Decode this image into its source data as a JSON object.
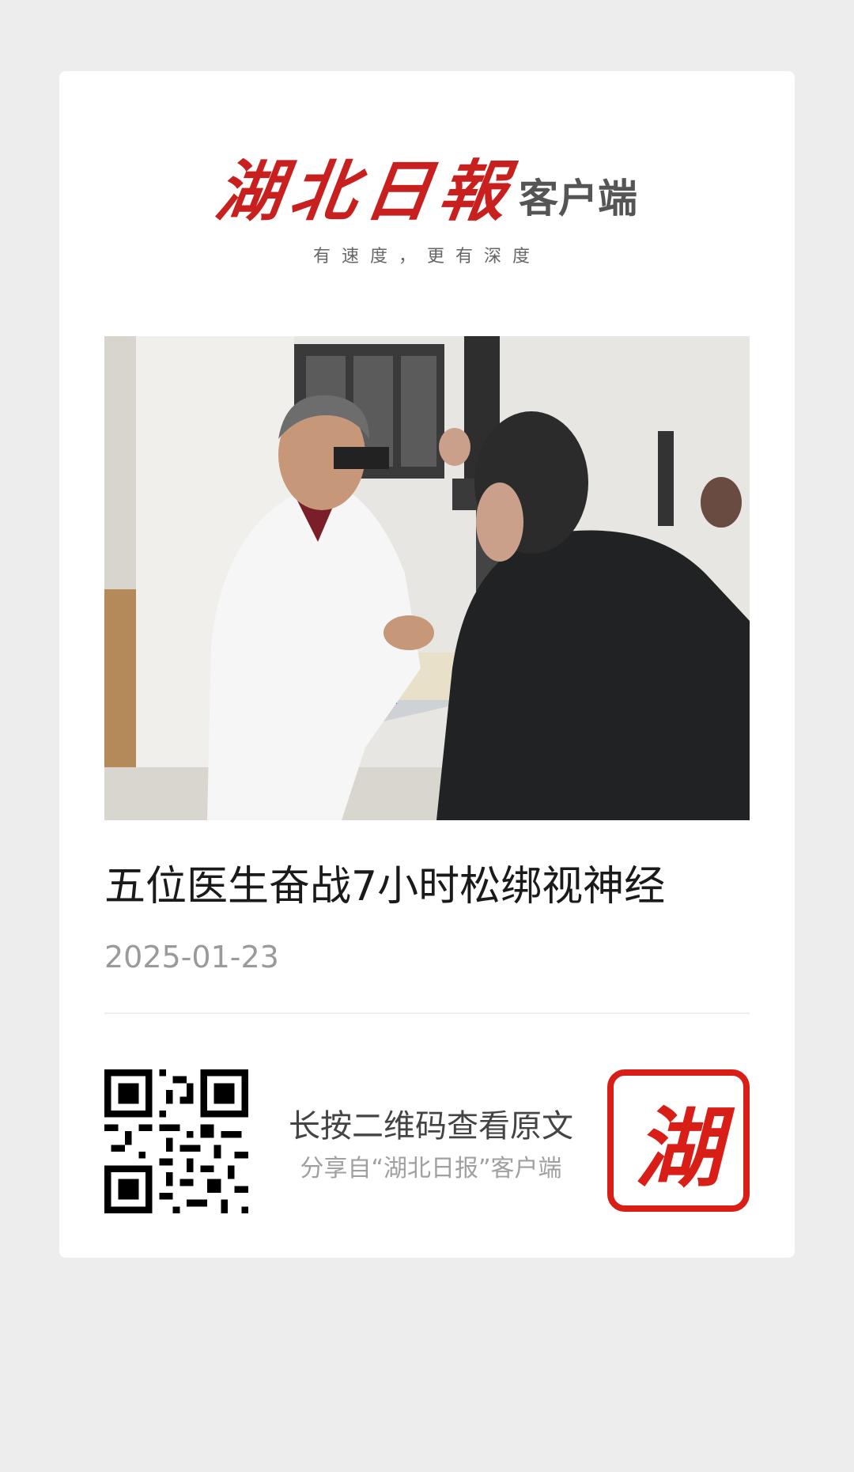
{
  "header": {
    "brand_main": "湖北日報",
    "brand_sub": "客户端",
    "slogan": "有速度，更有深度"
  },
  "article": {
    "title": "五位医生奋战7小时松绑视神经",
    "date": "2025-01-23"
  },
  "footer": {
    "main_text": "长按二维码查看原文",
    "sub_text": "分享自“湖北日报”客户端",
    "seal_char": "湖"
  },
  "colors": {
    "page_bg": "#ededed",
    "card_bg": "#ffffff",
    "brand_red": "#c8201f",
    "title_text": "#1a1a1a",
    "muted_text": "#9a9a9a"
  }
}
